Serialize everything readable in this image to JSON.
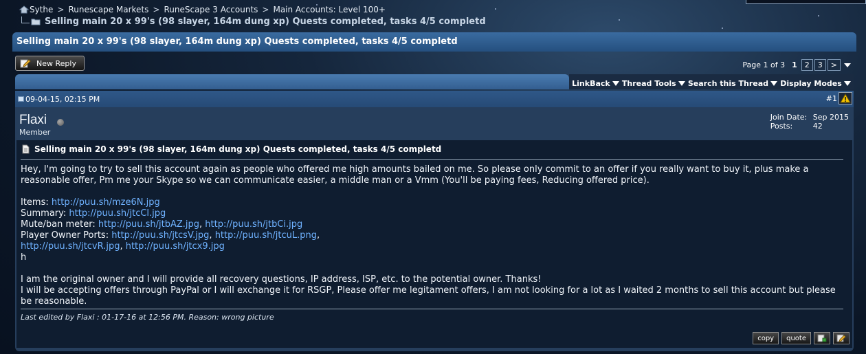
{
  "breadcrumb": {
    "items": [
      "Sythe",
      "Runescape Markets",
      "RuneScape 3 Accounts",
      "Main Accounts: Level 100+"
    ],
    "separator": ">",
    "current": "Selling main 20 x 99's (98 slayer, 164m dung xp) Quests completed, tasks 4/5 completd"
  },
  "thread": {
    "title": "Selling main 20 x 99's (98 slayer, 164m dung xp) Quests completed, tasks 4/5 completd"
  },
  "toolbar": {
    "new_reply": "New Reply",
    "page_of": "Page 1 of 3",
    "pages": [
      "1",
      "2",
      "3"
    ],
    "next": ">",
    "linkback": "LinkBack",
    "thread_tools": "Thread Tools",
    "search_thread": "Search this Thread",
    "display_modes": "Display Modes"
  },
  "post": {
    "date": "09-04-15, 02:15 PM",
    "number": "#1",
    "username": "Flaxi",
    "user_title": "Member",
    "join_date_label": "Join Date:",
    "join_date": "Sep 2015",
    "posts_label": "Posts:",
    "posts": "42",
    "title": "Selling main 20 x 99's (98 slayer, 164m dung xp) Quests completed, tasks 4/5 completd",
    "intro": "Hey, I'm going to try to sell this account again as people who offered me high amounts bailed on me. So please only commit to an offer if you really want to buy it, plus make a reasonable offer, Pm me your Skype so we can communicate easier, a middle man or a Vmm (You'll be paying fees, Reducing offered price).",
    "items_label": "Items:",
    "items_link": "http://puu.sh/mze6N.jpg",
    "summary_label": "Summary:",
    "summary_link": "http://puu.sh/jtcCl.jpg",
    "mute_label": "Mute/ban meter:",
    "mute_link1": "http://puu.sh/jtbAZ.jpg",
    "mute_link2": "http://puu.sh/jtbCi.jpg",
    "pop_label": "Player Owner Ports:",
    "pop_link1": "http://puu.sh/jtcsV.jpg",
    "pop_link2": "http://puu.sh/jtcuL.png",
    "pop_link3": "http://puu.sh/jtcvR.jpg",
    "pop_link4": "http://puu.sh/jtcx9.jpg",
    "stray": "h",
    "closing1": "I am the original owner and I will provide all recovery questions, IP address, ISP, etc. to the potential owner. Thanks!",
    "closing2": "I will be accepting offers through PayPal or I will exchange it for RSGP, Please offer me legitament offers, I am not looking for a lot as I waited 2 months to sell this account but please be reasonable.",
    "edited": "Last edited by Flaxi : 01-17-16 at 12:56 PM. Reason: wrong picture",
    "copy_label": "copy",
    "quote_label": "quote"
  },
  "icons": {
    "home": "home-icon",
    "folder": "folder-icon",
    "pen": "pencil-icon",
    "document": "document-icon",
    "warning": "warning-icon",
    "multiquote": "multiquote-icon",
    "edit": "edit-icon"
  },
  "colors": {
    "link": "#6fb2ff",
    "title_bar": "#2f5f94",
    "post_bg": "#0f1d30",
    "warning": "#f2c200"
  }
}
